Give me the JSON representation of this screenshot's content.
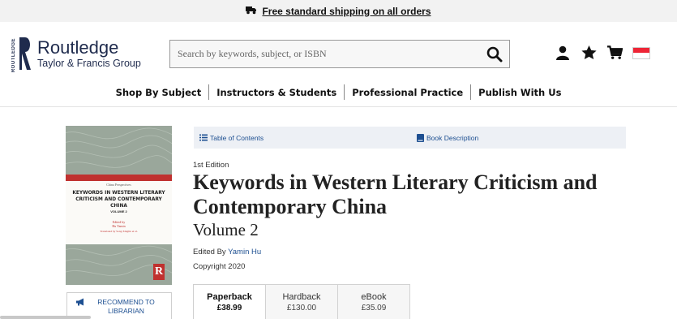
{
  "promo": {
    "icon": "truck-icon",
    "text": "Free standard shipping on all orders"
  },
  "brand": {
    "name": "Routledge",
    "subtitle": "Taylor & Francis Group",
    "vertical_text": "ROUTLEDGE"
  },
  "search": {
    "placeholder": "Search by keywords, subject, or ISBN",
    "value": "",
    "icon": "search-icon"
  },
  "header_icons": [
    "user-icon",
    "star-icon",
    "cart-icon",
    "singapore-flag-icon"
  ],
  "nav": [
    "Shop By Subject",
    "Instructors & Students",
    "Professional Practice",
    "Publish With Us"
  ],
  "cover": {
    "series": "China Perspectives",
    "title": "KEYWORDS IN WESTERN LITERARY CRITICISM AND CONTEMPORARY CHINA",
    "volume": "VOLUME 2",
    "edited_by_line": "Edited by",
    "editor": "Hu Yamin",
    "translated": "Translated by Song Xinglin et al.",
    "publisher_mark": "R"
  },
  "recommend": {
    "label": "RECOMMEND TO LIBRARIAN",
    "icon": "megaphone-icon"
  },
  "content_tabs": [
    {
      "label": "Table of Contents",
      "icon": "list-icon"
    },
    {
      "label": "Book Description",
      "icon": "book-icon"
    }
  ],
  "book": {
    "edition": "1st Edition",
    "title": "Keywords in Western Literary Criticism and Contemporary China",
    "volume": "Volume 2",
    "edited_by_label": "Edited By",
    "editor": "Yamin Hu",
    "copyright": "Copyright 2020"
  },
  "formats": [
    {
      "label": "Paperback",
      "price": "£38.99",
      "selected": true
    },
    {
      "label": "Hardback",
      "price": "£130.00",
      "selected": false
    },
    {
      "label": "eBook",
      "price": "£35.09",
      "selected": false
    }
  ],
  "colors": {
    "brand_navy": "#1f2b4d",
    "link_blue": "#1d4f91",
    "cover_green": "#9aa79b",
    "cover_red": "#c0312f"
  }
}
